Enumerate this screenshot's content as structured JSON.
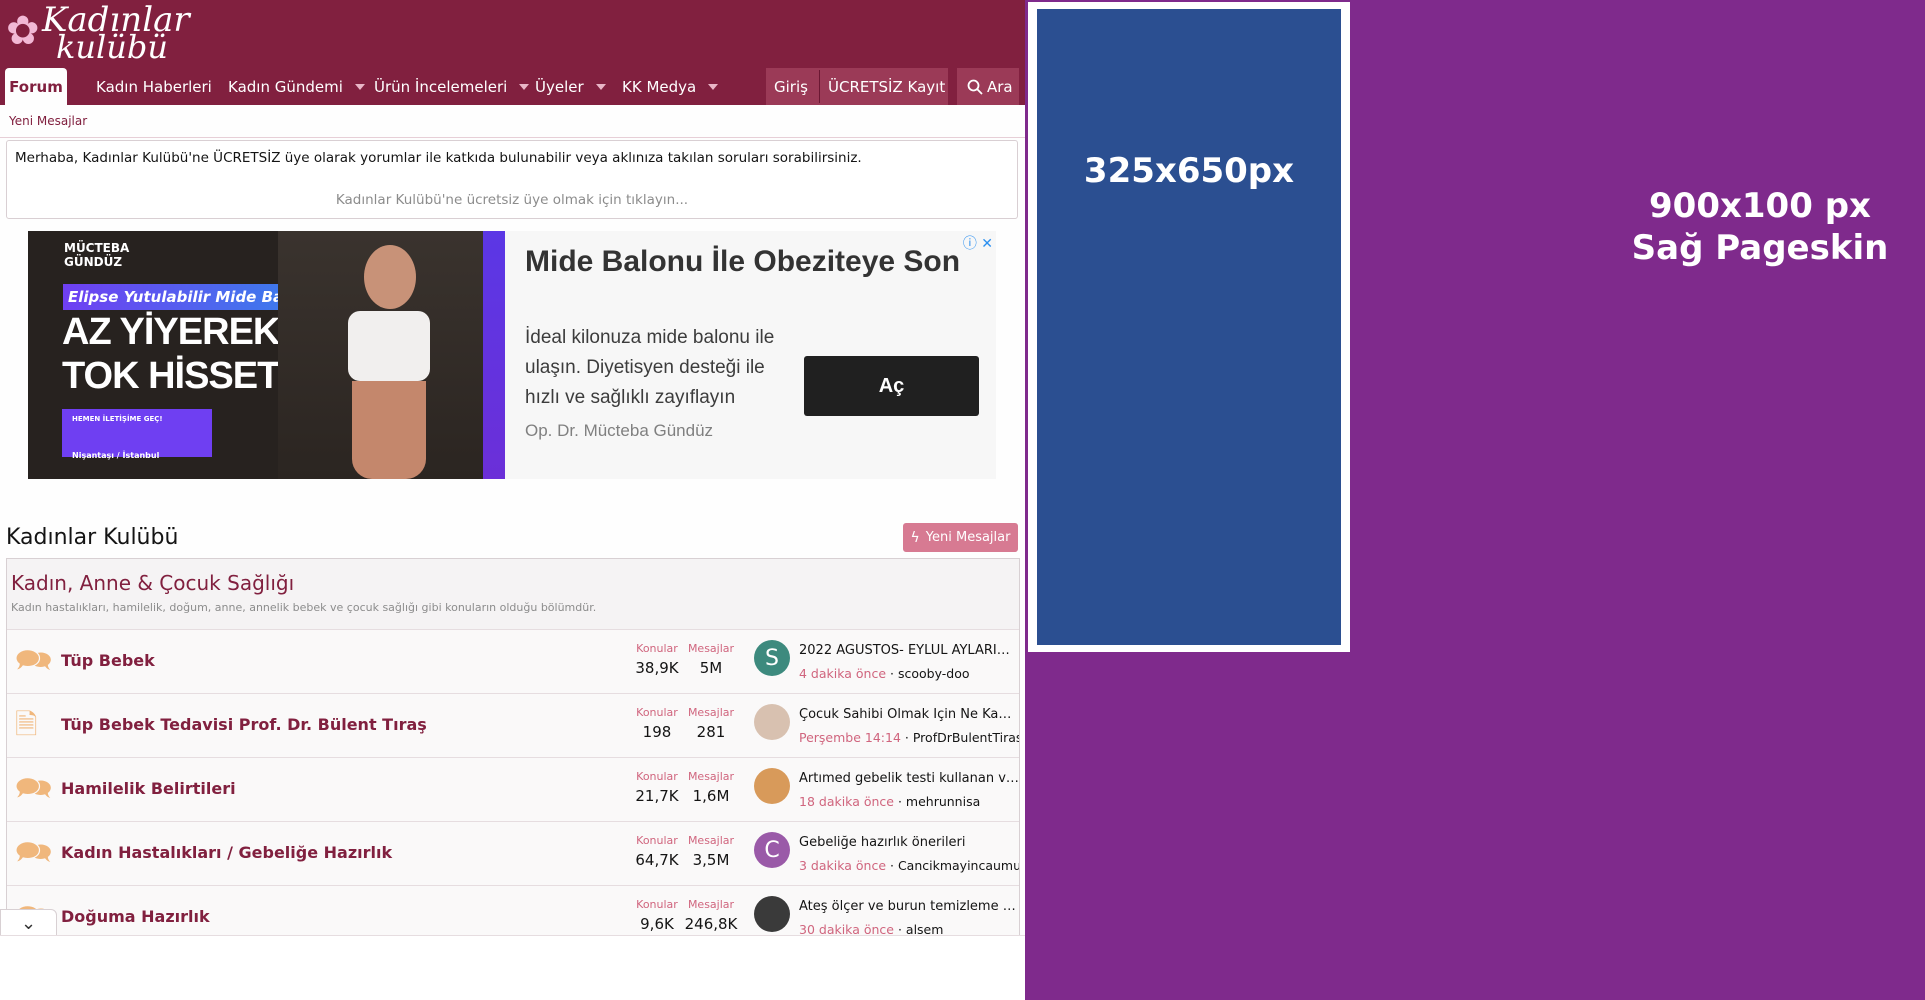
{
  "logo": {
    "line1": "Kadınlar",
    "line2": "kulübü"
  },
  "nav": {
    "tabs": [
      {
        "label": "Forum"
      },
      {
        "label": "Kadın Haberleri"
      },
      {
        "label": "Kadın Gündemi"
      },
      {
        "label": "Ürün İncelemeleri"
      },
      {
        "label": "Üyeler"
      },
      {
        "label": "KK Medya"
      }
    ],
    "login": "Giriş",
    "register": "ÜCRETSİZ Kayıt Ol",
    "search": "Ara"
  },
  "subnav": {
    "new_posts": "Yeni Mesajlar"
  },
  "notice": {
    "text": "Merhaba, Kadınlar Kulübü'ne ÜCRETSİZ üye olarak yorumlar ile katkıda bulunabilir veya aklınıza takılan soruları sorabilirsiniz.",
    "link": "Kadınlar Kulübü'ne ücretsiz üye olmak için tıklayın..."
  },
  "ad": {
    "brand_line1": "MÜCTEBA",
    "brand_line2": "GÜNDÜZ",
    "strip": "Elipse Yutulabilir Mide Balonu ile",
    "headline1": "AZ YİYEREK",
    "headline2": "TOK HİSSET",
    "small": "HEMEN İLETİŞİME GEÇ!",
    "location": "Nişantaşı / İstanbul",
    "title": "Mide Balonu İle Obeziteye Son",
    "copy": "İdeal kilonuza mide balonu ile ulaşın. Diyetisyen desteği ile hızlı ve sağlıklı zayıflayın",
    "sponsor": "Op. Dr. Mücteba Gündüz",
    "button": "Aç",
    "icons": "ⓘ ✕"
  },
  "block": {
    "title": "Kadınlar Kulübü",
    "new_button": "Yeni Mesajlar",
    "category": {
      "title": "Kadın, Anne & Çocuk Sağlığı",
      "desc": "Kadın hastalıkları, hamilelik, doğum, anne, annelik bebek ve çocuk sağlığı gibi konuların olduğu bölümdür."
    },
    "stat_labels": {
      "threads": "Konular",
      "posts": "Mesajlar"
    },
    "forums": [
      {
        "name": "Tüp Bebek",
        "icon": "chat-icon",
        "threads": "38,9K",
        "posts": "5M",
        "avatar": "S",
        "avatar_color": "#3d8a7e",
        "last_title": "2022 AĞUSTOS- EYLÜL AYLARINDA ...",
        "last_time": "4 dakika önce",
        "last_user": "scooby-doo"
      },
      {
        "name": "Tüp Bebek Tedavisi Prof. Dr. Bülent Tıraş",
        "icon": "document-icon",
        "threads": "198",
        "posts": "281",
        "avatar": "",
        "avatar_color": "#d8c1b0",
        "last_title": "Çocuk Sahibi Olmak İçin Ne Kadar S...",
        "last_time": "Perşembe 14:14",
        "last_user": "ProfDrBulentTiras"
      },
      {
        "name": "Hamilelik Belirtileri",
        "icon": "chat-icon",
        "threads": "21,7K",
        "posts": "1,6M",
        "avatar": "",
        "avatar_color": "#d89a5a",
        "last_title": "Artımed gebelik testi kullanan var mı?",
        "last_time": "18 dakika önce",
        "last_user": "mehrunnisa"
      },
      {
        "name": "Kadın Hastalıkları / Gebeliğe Hazırlık",
        "icon": "chat-icon",
        "threads": "64,7K",
        "posts": "3,5M",
        "avatar": "C",
        "avatar_color": "#9a5aa8",
        "last_title": "Gebeliğe hazırlık önerileri",
        "last_time": "3 dakika önce",
        "last_user": "Cancikmayincaumutkesilmez"
      },
      {
        "name": "Doğuma Hazırlık",
        "icon": "chat-icon",
        "threads": "9,6K",
        "posts": "246,8K",
        "avatar": "",
        "avatar_color": "#3a3a3a",
        "last_title": "Ateş ölçer ve burun temizleme alıca...",
        "last_time": "30 dakika önce",
        "last_user": "alsem"
      }
    ]
  },
  "skin": {
    "ad_label": "325x650px",
    "label_line1": "900x100 px",
    "label_line2": "Sağ Pageskin"
  },
  "colors": {
    "brand": "#81203f",
    "skin": "#7f2a8c",
    "ad_blue": "#2b4f91",
    "accent_pink": "#d77a92"
  }
}
